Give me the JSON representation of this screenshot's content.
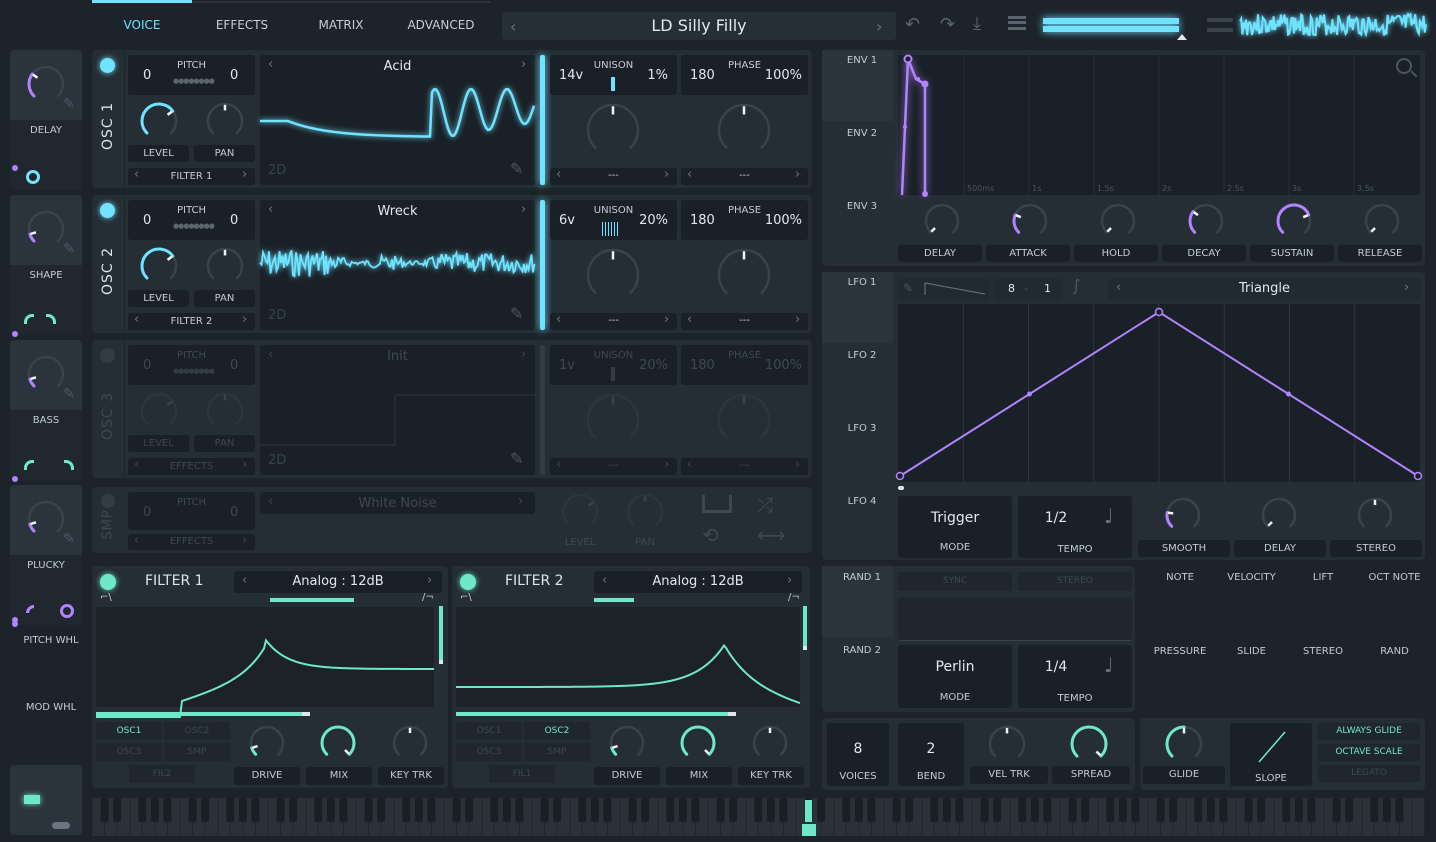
{
  "colors": {
    "osc": "#6fe3ff",
    "filter": "#6fe8c9",
    "mod": "#b283ff",
    "track": "#3a434c",
    "panel": "#252d35",
    "background": "#1c232a"
  },
  "tabs": [
    {
      "label": "VOICE",
      "active": true
    },
    {
      "label": "EFFECTS"
    },
    {
      "label": "MATRIX"
    },
    {
      "label": "ADVANCED"
    }
  ],
  "preset": {
    "name": "LD Silly Filly",
    "prev_icon": "chevron-left-icon",
    "next_icon": "chevron-right-icon"
  },
  "toolbar_icons": [
    "undo-icon",
    "redo-icon",
    "save-icon",
    "menu-icon"
  ],
  "macros": [
    {
      "label": "DELAY",
      "value": 0.3
    },
    {
      "label": "SHAPE",
      "value": 0.1
    },
    {
      "label": "BASS",
      "value": 0.1
    },
    {
      "label": "PLUCKY",
      "value": 0.1
    }
  ],
  "wheels": {
    "pitch_label": "PITCH WHL",
    "mod_label": "MOD WHL"
  },
  "oscillators": [
    {
      "name": "OSC 1",
      "enabled": true,
      "pitch_label": "PITCH",
      "pitch_left": "0",
      "pitch_right": "0",
      "level_label": "LEVEL",
      "pan_label": "PAN",
      "level": 0.7,
      "pan": 0.5,
      "destination": "FILTER 1",
      "wavetable": "Acid",
      "dim": "2D",
      "unison_label": "UNISON",
      "unison_voices": "14v",
      "unison_detune": "1%",
      "phase_label": "PHASE",
      "phase": "180",
      "phase_random": "100%",
      "unison_select": "---",
      "phase_select": "---"
    },
    {
      "name": "OSC 2",
      "enabled": true,
      "pitch_label": "PITCH",
      "pitch_left": "0",
      "pitch_right": "0",
      "level_label": "LEVEL",
      "pan_label": "PAN",
      "level": 0.7,
      "pan": 0.5,
      "destination": "FILTER 2",
      "wavetable": "Wreck",
      "dim": "2D",
      "unison_label": "UNISON",
      "unison_voices": "6v",
      "unison_detune": "20%",
      "phase_label": "PHASE",
      "phase": "180",
      "phase_random": "100%",
      "unison_select": "---",
      "phase_select": "---"
    },
    {
      "name": "OSC 3",
      "enabled": false,
      "pitch_label": "PITCH",
      "pitch_left": "0",
      "pitch_right": "0",
      "level_label": "LEVEL",
      "pan_label": "PAN",
      "level": 0.7,
      "pan": 0.5,
      "destination": "EFFECTS",
      "wavetable": "Init",
      "dim": "2D",
      "unison_label": "UNISON",
      "unison_voices": "1v",
      "unison_detune": "20%",
      "phase_label": "PHASE",
      "phase": "180",
      "phase_random": "100%",
      "unison_select": "---",
      "phase_select": "---"
    }
  ],
  "sample": {
    "name": "SMP",
    "enabled": false,
    "pitch_label": "PITCH",
    "pitch_left": "0",
    "pitch_right": "0",
    "destination": "EFFECTS",
    "source": "White Noise",
    "level_label": "LEVEL",
    "pan_label": "PAN",
    "level": 0.7,
    "pan": 0.5
  },
  "filters": [
    {
      "name": "FILTER 1",
      "enabled": true,
      "model": "Analog : 12dB",
      "blend": 0.45,
      "cutoff": 0.5,
      "resonance": 0.72,
      "sources": [
        {
          "label": "OSC1",
          "on": true
        },
        {
          "label": "OSC2",
          "on": false
        },
        {
          "label": "OSC3",
          "on": false
        },
        {
          "label": "SMP",
          "on": false
        }
      ],
      "chain": "FIL2",
      "drive_label": "DRIVE",
      "mix_label": "MIX",
      "keytrk_label": "KEY TRK",
      "drive": 0.1,
      "mix": 1.0,
      "keytrk": 0.5
    },
    {
      "name": "FILTER 2",
      "enabled": true,
      "model": "Analog : 12dB",
      "blend": 0.1,
      "cutoff": 0.78,
      "resonance": 0.76,
      "sources": [
        {
          "label": "OSC1",
          "on": false
        },
        {
          "label": "OSC2",
          "on": true
        },
        {
          "label": "OSC3",
          "on": false
        },
        {
          "label": "SMP",
          "on": false
        }
      ],
      "chain": "FIL1",
      "drive_label": "DRIVE",
      "mix_label": "MIX",
      "keytrk_label": "KEY TRK",
      "drive": 0.1,
      "mix": 1.0,
      "keytrk": 0.5
    }
  ],
  "envelopes": {
    "tabs": [
      "ENV 1",
      "ENV 2",
      "ENV 3"
    ],
    "time_labels": [
      "500ms",
      "1s",
      "1.5s",
      "2s",
      "2.5s",
      "3s",
      "3.5s"
    ],
    "knobs": [
      {
        "label": "DELAY",
        "value": 0.0
      },
      {
        "label": "ATTACK",
        "value": 0.25
      },
      {
        "label": "HOLD",
        "value": 0.0
      },
      {
        "label": "DECAY",
        "value": 0.3
      },
      {
        "label": "SUSTAIN",
        "value": 0.75
      },
      {
        "label": "RELEASE",
        "value": 0.0
      }
    ]
  },
  "lfos": {
    "tabs": [
      "LFO 1",
      "LFO 2",
      "LFO 3",
      "LFO 4"
    ],
    "grid_x": "8",
    "grid_y": "1",
    "shape": "Triangle",
    "mode": "Trigger",
    "mode_label": "MODE",
    "tempo": "1/2",
    "tempo_label": "TEMPO",
    "knobs": [
      {
        "label": "SMOOTH",
        "value": 0.2
      },
      {
        "label": "DELAY",
        "value": 0.0
      },
      {
        "label": "STEREO",
        "value": 0.5
      }
    ]
  },
  "random": {
    "tabs": [
      "RAND 1",
      "RAND 2"
    ],
    "sync": "SYNC",
    "stereo": "STEREO",
    "mode": "Perlin",
    "mode_label": "MODE",
    "tempo": "1/4",
    "tempo_label": "TEMPO"
  },
  "keyboard_mods": [
    "NOTE",
    "VELOCITY",
    "LIFT",
    "OCT NOTE",
    "PRESSURE",
    "SLIDE",
    "STEREO",
    "RAND"
  ],
  "voice": {
    "voices": "8",
    "voices_label": "VOICES",
    "bend": "2",
    "bend_label": "BEND",
    "veltrk_label": "VEL TRK",
    "veltrk": 0.5,
    "spread_label": "SPREAD",
    "spread": 1.0
  },
  "glide": {
    "glide_label": "GLIDE",
    "glide": 0.5,
    "slope_label": "SLOPE",
    "always_glide": "ALWAYS GLIDE",
    "octave_scale": "OCTAVE SCALE",
    "legato": "LEGATO"
  }
}
